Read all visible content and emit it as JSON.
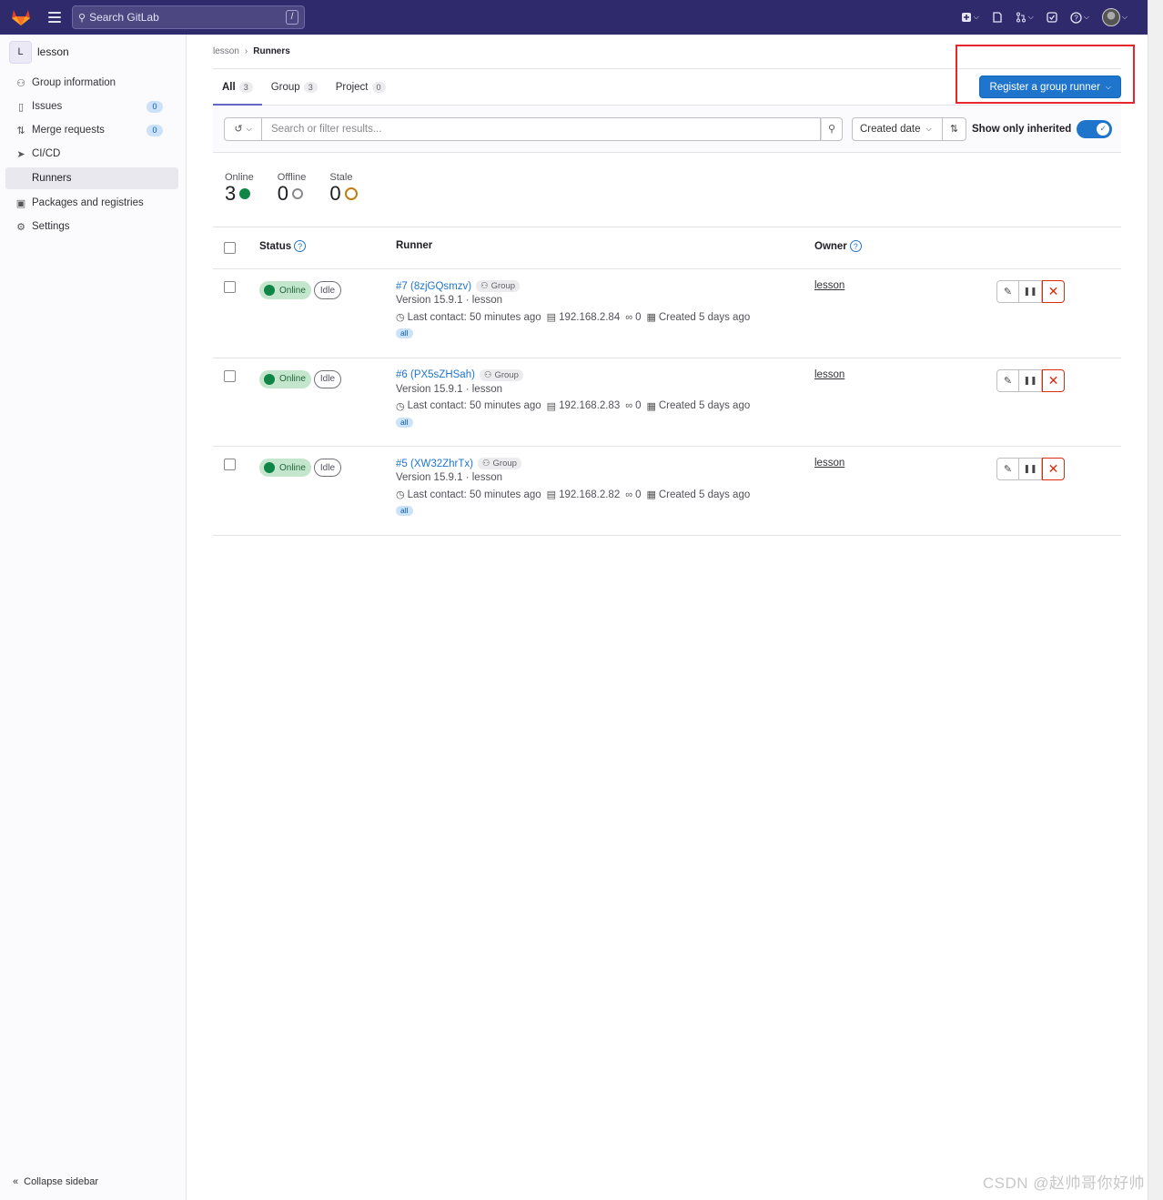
{
  "topbar": {
    "search_placeholder": "Search GitLab",
    "search_shortcut": "/",
    "icons": [
      "plus-square-icon",
      "issues-icon",
      "merge-request-icon",
      "todo-icon",
      "help-icon",
      "avatar"
    ]
  },
  "sidebar": {
    "context_initial": "L",
    "context_name": "lesson",
    "items": [
      {
        "label": "Group information",
        "icon": "group-icon"
      },
      {
        "label": "Issues",
        "icon": "issues-icon",
        "count": "0"
      },
      {
        "label": "Merge requests",
        "icon": "merge-request-icon",
        "count": "0"
      },
      {
        "label": "CI/CD",
        "icon": "rocket-icon"
      },
      {
        "label": "Runners",
        "sub": true
      },
      {
        "label": "Packages and registries",
        "icon": "package-icon"
      },
      {
        "label": "Settings",
        "icon": "gear-icon"
      }
    ],
    "collapse_label": "Collapse sidebar"
  },
  "breadcrumb": {
    "parent": "lesson",
    "current": "Runners"
  },
  "tabs": [
    {
      "label": "All",
      "count": "3",
      "active": true
    },
    {
      "label": "Group",
      "count": "3"
    },
    {
      "label": "Project",
      "count": "0"
    }
  ],
  "register_button": "Register a group runner",
  "filter": {
    "placeholder": "Search or filter results...",
    "sort_label": "Created date",
    "inherited_label": "Show only inherited",
    "inherited_on": true
  },
  "stats": [
    {
      "label": "Online",
      "value": "3"
    },
    {
      "label": "Offline",
      "value": "0"
    },
    {
      "label": "Stale",
      "value": "0"
    }
  ],
  "table": {
    "headers": {
      "status": "Status",
      "runner": "Runner",
      "owner": "Owner"
    },
    "rows": [
      {
        "status": "Online",
        "state": "Idle",
        "name": "#7 (8zjGQsmzv)",
        "type": "Group",
        "version": "Version 15.9.1 · lesson",
        "contact": "Last contact: 50 minutes ago",
        "ip": "192.168.2.84",
        "jobs": "0",
        "created": "Created 5 days ago",
        "tag": "all",
        "owner": "lesson"
      },
      {
        "status": "Online",
        "state": "Idle",
        "name": "#6 (PX5sZHSah)",
        "type": "Group",
        "version": "Version 15.9.1 · lesson",
        "contact": "Last contact: 50 minutes ago",
        "ip": "192.168.2.83",
        "jobs": "0",
        "created": "Created 5 days ago",
        "tag": "all",
        "owner": "lesson"
      },
      {
        "status": "Online",
        "state": "Idle",
        "name": "#5 (XW32ZhrTx)",
        "type": "Group",
        "version": "Version 15.9.1 · lesson",
        "contact": "Last contact: 50 minutes ago",
        "ip": "192.168.2.82",
        "jobs": "0",
        "created": "Created 5 days ago",
        "tag": "all",
        "owner": "lesson"
      }
    ]
  },
  "watermark": "CSDN @赵帅哥你好帅",
  "colors": {
    "navbar": "#2f2a6b",
    "primary": "#1f75cb",
    "online": "#108548",
    "danger": "#dd2b0e",
    "highlight_box": "#e8262f"
  }
}
